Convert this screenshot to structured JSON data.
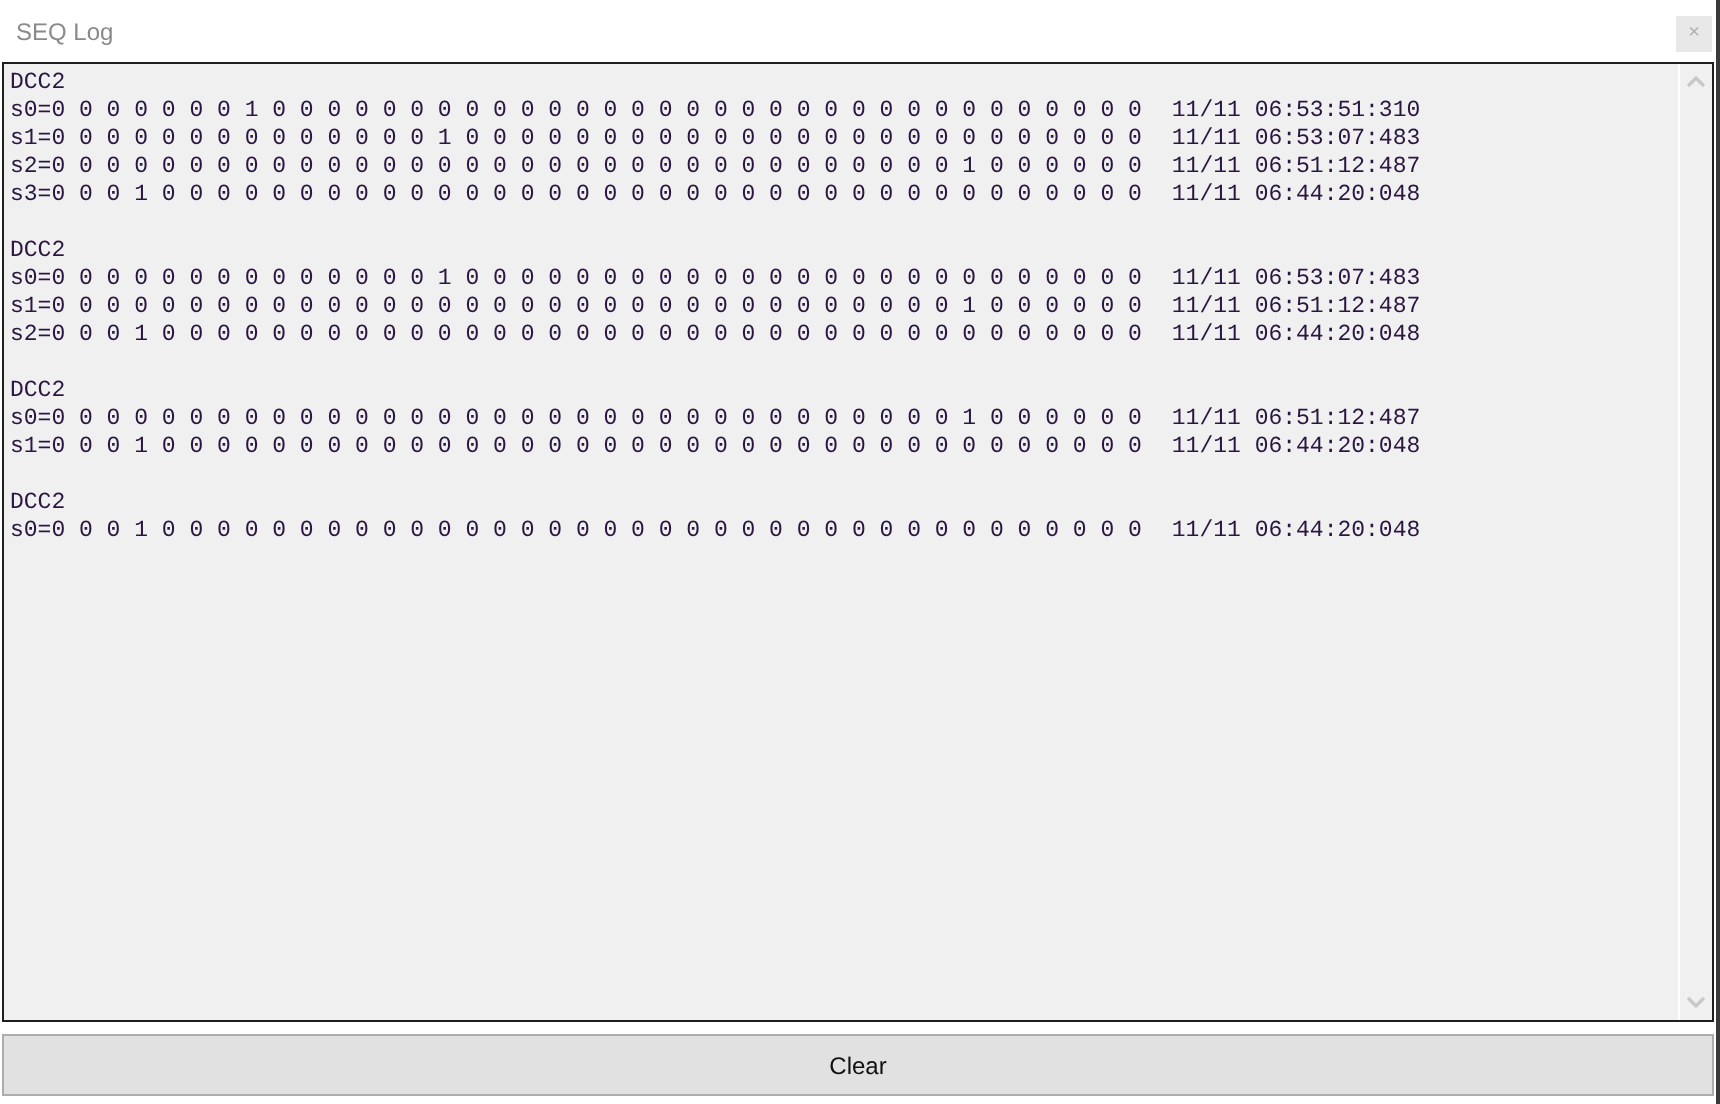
{
  "window": {
    "title": "SEQ Log",
    "close": "×"
  },
  "log": [
    {
      "header": "DCC2",
      "rows": [
        {
          "values": "s0=0 0 0 0 0 0 0 1 0 0 0 0 0 0 0 0 0 0 0 0 0 0 0 0 0 0 0 0 0 0 0 0 0 0 0 0 0 0 0 0",
          "timestamp": "11/11 06:53:51:310"
        },
        {
          "values": "s1=0 0 0 0 0 0 0 0 0 0 0 0 0 0 1 0 0 0 0 0 0 0 0 0 0 0 0 0 0 0 0 0 0 0 0 0 0 0 0 0",
          "timestamp": "11/11 06:53:07:483"
        },
        {
          "values": "s2=0 0 0 0 0 0 0 0 0 0 0 0 0 0 0 0 0 0 0 0 0 0 0 0 0 0 0 0 0 0 0 0 0 1 0 0 0 0 0 0",
          "timestamp": "11/11 06:51:12:487"
        },
        {
          "values": "s3=0 0 0 1 0 0 0 0 0 0 0 0 0 0 0 0 0 0 0 0 0 0 0 0 0 0 0 0 0 0 0 0 0 0 0 0 0 0 0 0",
          "timestamp": "11/11 06:44:20:048"
        }
      ]
    },
    {
      "header": "DCC2",
      "rows": [
        {
          "values": "s0=0 0 0 0 0 0 0 0 0 0 0 0 0 0 1 0 0 0 0 0 0 0 0 0 0 0 0 0 0 0 0 0 0 0 0 0 0 0 0 0",
          "timestamp": "11/11 06:53:07:483"
        },
        {
          "values": "s1=0 0 0 0 0 0 0 0 0 0 0 0 0 0 0 0 0 0 0 0 0 0 0 0 0 0 0 0 0 0 0 0 0 1 0 0 0 0 0 0",
          "timestamp": "11/11 06:51:12:487"
        },
        {
          "values": "s2=0 0 0 1 0 0 0 0 0 0 0 0 0 0 0 0 0 0 0 0 0 0 0 0 0 0 0 0 0 0 0 0 0 0 0 0 0 0 0 0",
          "timestamp": "11/11 06:44:20:048"
        }
      ]
    },
    {
      "header": "DCC2",
      "rows": [
        {
          "values": "s0=0 0 0 0 0 0 0 0 0 0 0 0 0 0 0 0 0 0 0 0 0 0 0 0 0 0 0 0 0 0 0 0 0 1 0 0 0 0 0 0",
          "timestamp": "11/11 06:51:12:487"
        },
        {
          "values": "s1=0 0 0 1 0 0 0 0 0 0 0 0 0 0 0 0 0 0 0 0 0 0 0 0 0 0 0 0 0 0 0 0 0 0 0 0 0 0 0 0",
          "timestamp": "11/11 06:44:20:048"
        }
      ]
    },
    {
      "header": "DCC2",
      "rows": [
        {
          "values": "s0=0 0 0 1 0 0 0 0 0 0 0 0 0 0 0 0 0 0 0 0 0 0 0 0 0 0 0 0 0 0 0 0 0 0 0 0 0 0 0 0",
          "timestamp": "11/11 06:44:20:048"
        }
      ]
    }
  ],
  "buttons": [
    {
      "label": "Clear"
    }
  ]
}
